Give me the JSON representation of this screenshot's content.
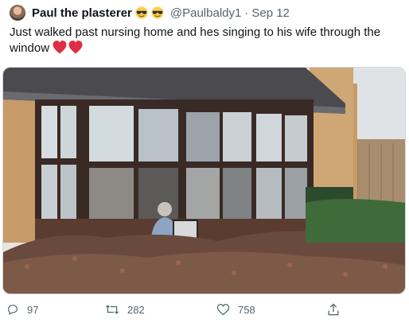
{
  "tweet": {
    "author": "Paul the plasterer",
    "handle": "@Paulbaldy1",
    "separator": "·",
    "date": "Sep 12",
    "text": "Just walked past nursing home and hes singing to his wife through the window",
    "name_emojis": [
      "sunglasses-emoji",
      "sunglasses-emoji"
    ],
    "text_emojis": [
      "red-heart-emoji",
      "red-heart-emoji"
    ]
  },
  "actions": {
    "replies": "97",
    "retweets": "282",
    "likes": "758"
  },
  "colors": {
    "secondary_text": "#536471",
    "heart_red": "#e0245e",
    "emoji_yellow": "#ffcc4d"
  }
}
